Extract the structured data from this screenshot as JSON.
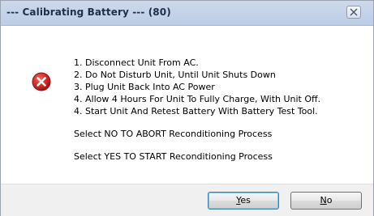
{
  "window": {
    "title": "--- Calibrating Battery --- (80)"
  },
  "message": {
    "steps": [
      "1. Disconnect Unit From AC.",
      "2. Do Not Disturb Unit, Until Unit Shuts Down",
      "3. Plug Unit Back Into AC Power",
      "4. Allow 4 Hours For Unit To Fully Charge, With Unit Off.",
      "4. Start Unit And Retest Battery With Battery Test Tool."
    ],
    "abort_text": "Select NO TO ABORT Reconditioning Process",
    "start_text": "Select YES TO START Reconditioning Process"
  },
  "buttons": {
    "yes": {
      "mnemonic": "Y",
      "rest": "es"
    },
    "no": {
      "mnemonic": "N",
      "rest": "o"
    }
  },
  "icons": {
    "message_icon": "error-icon",
    "close_icon": "close-icon"
  },
  "colors": {
    "title_bar": "#c8d6eb",
    "error_red": "#d32a26",
    "footer": "#f0f0f0"
  }
}
